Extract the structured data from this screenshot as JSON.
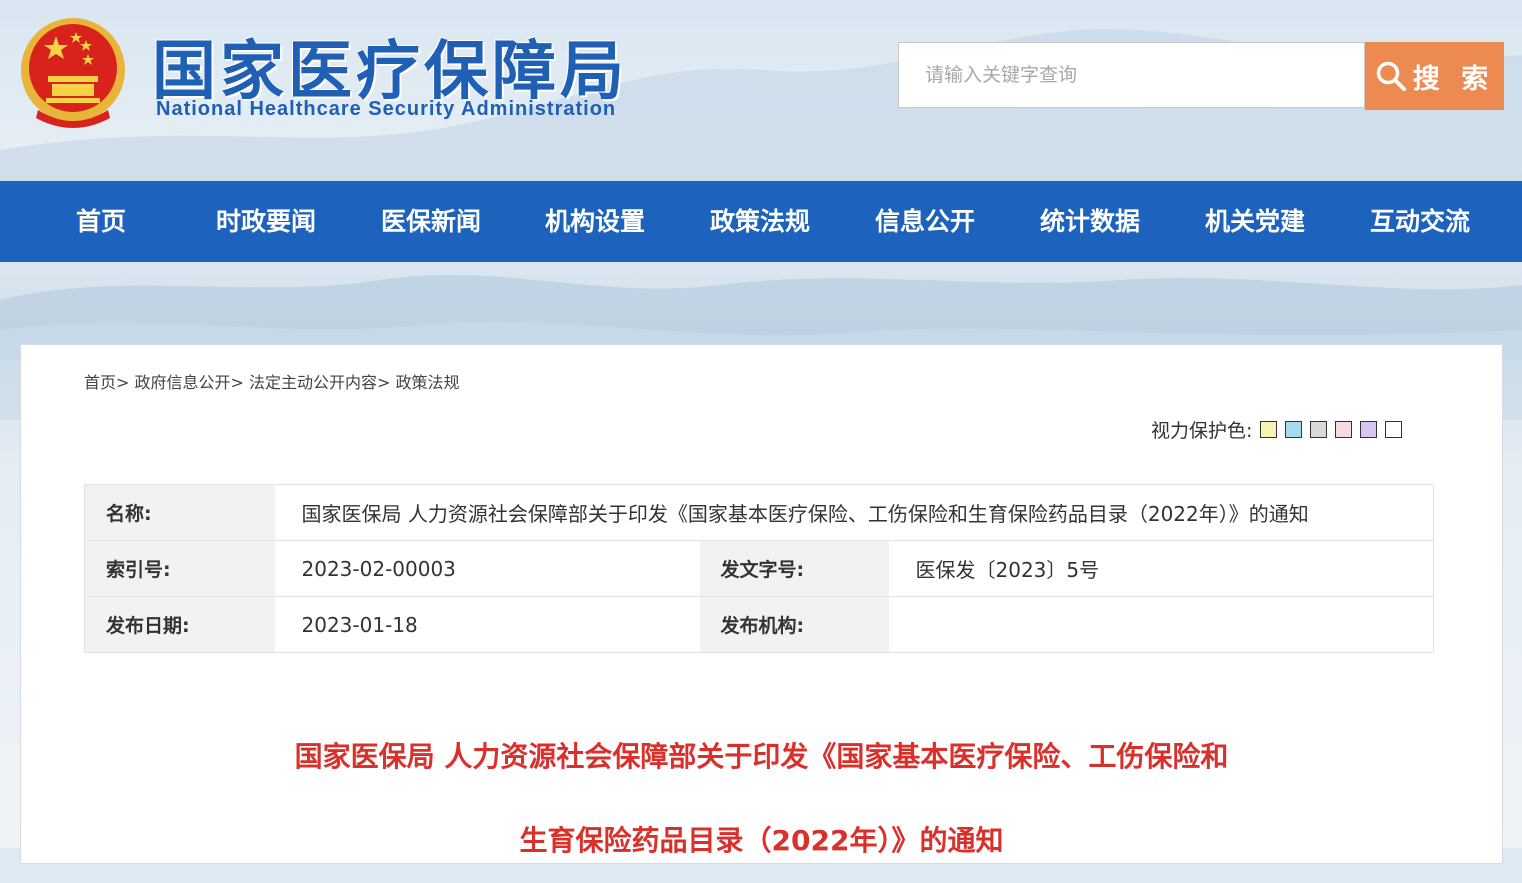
{
  "header": {
    "logo_cn": "国家医疗保障局",
    "logo_en": "National Healthcare Security Administration",
    "search": {
      "placeholder": "请输入关键字查询",
      "button_label": "搜 索"
    }
  },
  "nav": {
    "items": [
      {
        "label": "首页"
      },
      {
        "label": "时政要闻"
      },
      {
        "label": "医保新闻"
      },
      {
        "label": "机构设置"
      },
      {
        "label": "政策法规"
      },
      {
        "label": "信息公开"
      },
      {
        "label": "统计数据"
      },
      {
        "label": "机关党建"
      },
      {
        "label": "互动交流"
      }
    ]
  },
  "breadcrumb": {
    "items": [
      "首页",
      "政府信息公开",
      "法定主动公开内容",
      "政策法规"
    ],
    "separator": "> "
  },
  "eye_protect": {
    "label": "视力保护色:",
    "colors": [
      "#f7f4b3",
      "#a8daf2",
      "#d8d8d8",
      "#f9d9dc",
      "#d8c6f0",
      "#ffffff"
    ]
  },
  "info_table": {
    "name_label": "名称:",
    "name_value": "国家医保局 人力资源社会保障部关于印发《国家基本医疗保险、工伤保险和生育保险药品目录（2022年）》的通知",
    "index_label": "索引号:",
    "index_value": "2023-02-00003",
    "doc_no_label": "发文字号:",
    "doc_no_value": "医保发〔2023〕5号",
    "date_label": "发布日期:",
    "date_value": "2023-01-18",
    "org_label": "发布机构:",
    "org_value": ""
  },
  "document": {
    "title_line1": "国家医保局 人力资源社会保障部关于印发《国家基本医疗保险、工伤保险和",
    "title_line2": "生育保险药品目录（2022年）》的通知"
  },
  "colors": {
    "nav_bg": "#1d62bd",
    "search_button": "#ec8a52",
    "title_red": "#d9302b",
    "logo_blue": "#1f5fb4"
  }
}
